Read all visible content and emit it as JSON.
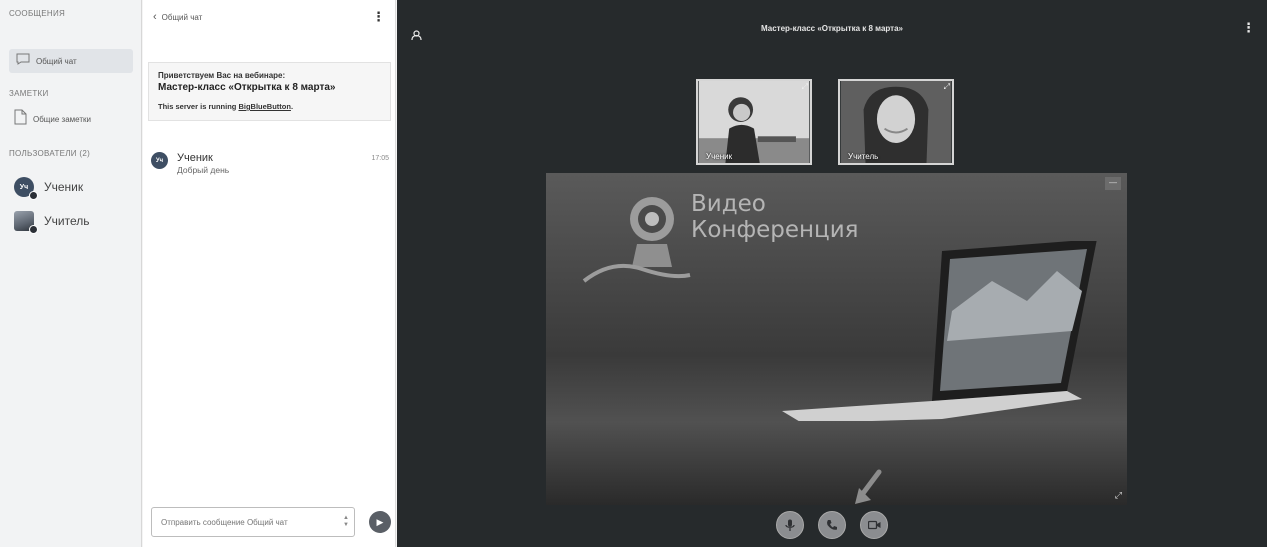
{
  "sidebar": {
    "messages_title": "СООБЩЕНИЯ",
    "public_chat_label": "Общий чат",
    "notes_title": "ЗАМЕТКИ",
    "shared_notes_label": "Общие заметки",
    "users_title": "ПОЛЬЗОВАТЕЛИ (2)",
    "users": [
      {
        "initials": "Уч",
        "name": "Ученик"
      },
      {
        "initials": "",
        "name": "Учитель"
      }
    ]
  },
  "chat": {
    "back_label": "‹",
    "title": "Общий чат",
    "welcome_line1": "Приветствуем Вас на вебинаре:",
    "welcome_line2": "Мастер-класс «Открытка к 8 марта»",
    "welcome_line3_prefix": "This server is running ",
    "welcome_line3_link": "BigBlueButton",
    "welcome_line3_suffix": ".",
    "messages": [
      {
        "initials": "Уч",
        "name": "Ученик",
        "text": "Добрый день",
        "time": "17:05"
      }
    ],
    "input_placeholder": "Отправить сообщение Общий чат"
  },
  "main": {
    "title": "Мастер-класс «Открытка к 8 марта»",
    "tiles": [
      {
        "name": "Ученик"
      },
      {
        "name": "Учитель"
      }
    ],
    "brand_line1": "Видео",
    "brand_line2": "Конференция"
  },
  "colors": {
    "main_bg": "#262a2c",
    "avatar_bg": "#3e4e63",
    "control_bg": "#8b8d90"
  },
  "icons": {
    "public_chat": "speech-bubble-icon",
    "shared_notes": "document-icon",
    "send": "send-arrow-icon",
    "microphone": "microphone-icon",
    "phone": "phone-icon",
    "camera": "camera-icon"
  }
}
